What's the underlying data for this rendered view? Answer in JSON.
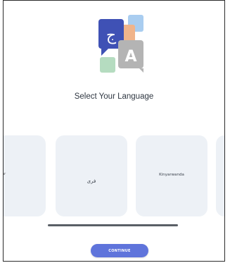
{
  "logo": {
    "glyph_arabic": "ج",
    "glyph_latin": "A",
    "colors": {
      "blue_bubble": "#3f51b5",
      "peach_bubble": "#f0b48b",
      "light_blue": "#a9cdf0",
      "mint": "#b5dcc0",
      "gray_bubble": "#b4b4b4"
    }
  },
  "title": "Select Your Language",
  "languages": [
    "ar",
    "فری",
    "Kinyarwanda",
    ""
  ],
  "cta": {
    "label": "CONTINUE",
    "color": "#5f74db"
  }
}
